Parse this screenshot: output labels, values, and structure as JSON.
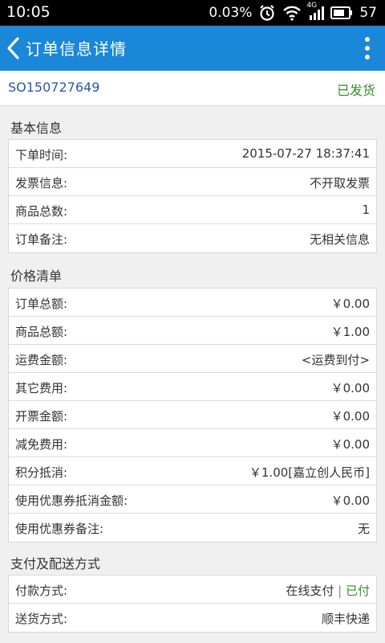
{
  "status_bar": {
    "time": "10:05",
    "data_rate": "0.03%",
    "network_label": "4G",
    "battery": "57",
    "icons": [
      "alarm-icon",
      "wifi-icon",
      "signal-icon",
      "battery-icon"
    ]
  },
  "app_bar": {
    "title": "订单信息详情",
    "back_icon": "chevron-left-icon",
    "menu_icon": "more-vertical-icon",
    "color": "#1a87d8"
  },
  "order": {
    "number": "SO150727649",
    "status": "已发货"
  },
  "basic_info": {
    "title": "基本信息",
    "rows": [
      {
        "label": "下单时间:",
        "value": "2015-07-27 18:37:41"
      },
      {
        "label": "发票信息:",
        "value": "不开取发票"
      },
      {
        "label": "商品总数:",
        "value": "1"
      },
      {
        "label": "订单备注:",
        "value": "无相关信息"
      }
    ]
  },
  "price_list": {
    "title": "价格清单",
    "rows": [
      {
        "label": "订单总额:",
        "value": "￥0.00"
      },
      {
        "label": "商品总额:",
        "value": "￥1.00"
      },
      {
        "label": "运费金额:",
        "value": "<运费到付>"
      },
      {
        "label": "其它费用:",
        "value": "￥0.00"
      },
      {
        "label": "开票金额:",
        "value": "￥0.00"
      },
      {
        "label": "减免费用:",
        "value": "￥0.00"
      },
      {
        "label": "积分抵消:",
        "value": "￥1.00[嘉立创人民币]"
      },
      {
        "label": "使用优惠券抵消金额:",
        "value": "￥0.00"
      },
      {
        "label": "使用优惠券备注:",
        "value": "无"
      }
    ]
  },
  "payment_delivery": {
    "title": "支付及配送方式",
    "payment": {
      "label": "付款方式:",
      "method": "在线支付",
      "separator": "|",
      "paid": "已付"
    },
    "delivery": {
      "label": "送货方式:",
      "value": "顺丰快递"
    }
  }
}
